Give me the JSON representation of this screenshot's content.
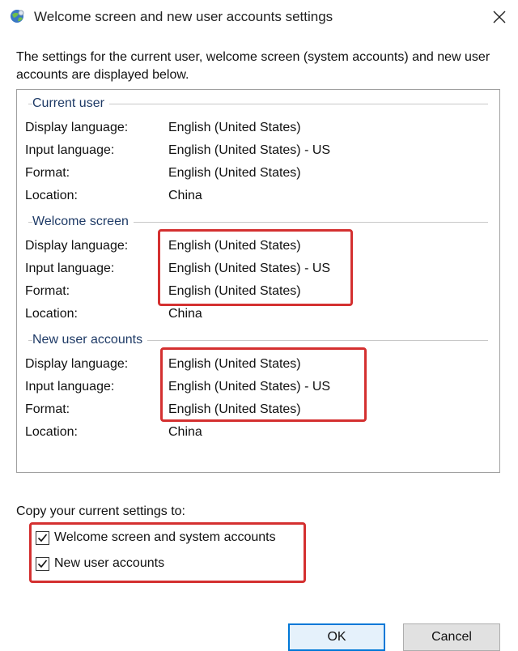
{
  "window": {
    "title": "Welcome screen and new user accounts settings"
  },
  "intro_text": "The settings for the current user, welcome screen (system accounts) and new user accounts are displayed below.",
  "groups": [
    {
      "title": "Current user",
      "rows": [
        {
          "label": "Display language:",
          "value": "English (United States)"
        },
        {
          "label": "Input language:",
          "value": "English (United States) - US"
        },
        {
          "label": "Format:",
          "value": "English (United States)"
        },
        {
          "label": "Location:",
          "value": "China"
        }
      ]
    },
    {
      "title": "Welcome screen",
      "rows": [
        {
          "label": "Display language:",
          "value": "English (United States)"
        },
        {
          "label": "Input language:",
          "value": "English (United States) - US"
        },
        {
          "label": "Format:",
          "value": "English (United States)"
        },
        {
          "label": "Location:",
          "value": "China"
        }
      ]
    },
    {
      "title": "New user accounts",
      "rows": [
        {
          "label": "Display language:",
          "value": "English (United States)"
        },
        {
          "label": "Input language:",
          "value": "English (United States) - US"
        },
        {
          "label": "Format:",
          "value": "English (United States)"
        },
        {
          "label": "Location:",
          "value": "China"
        }
      ]
    }
  ],
  "copy_section": {
    "label": "Copy your current settings to:",
    "options": [
      {
        "label": "Welcome screen and system accounts",
        "checked": true
      },
      {
        "label": "New user accounts",
        "checked": true
      }
    ]
  },
  "buttons": {
    "ok": "OK",
    "cancel": "Cancel"
  },
  "colors": {
    "highlight": "#d43030",
    "group_title": "#1e3a66",
    "focus_border": "#0078d7"
  }
}
